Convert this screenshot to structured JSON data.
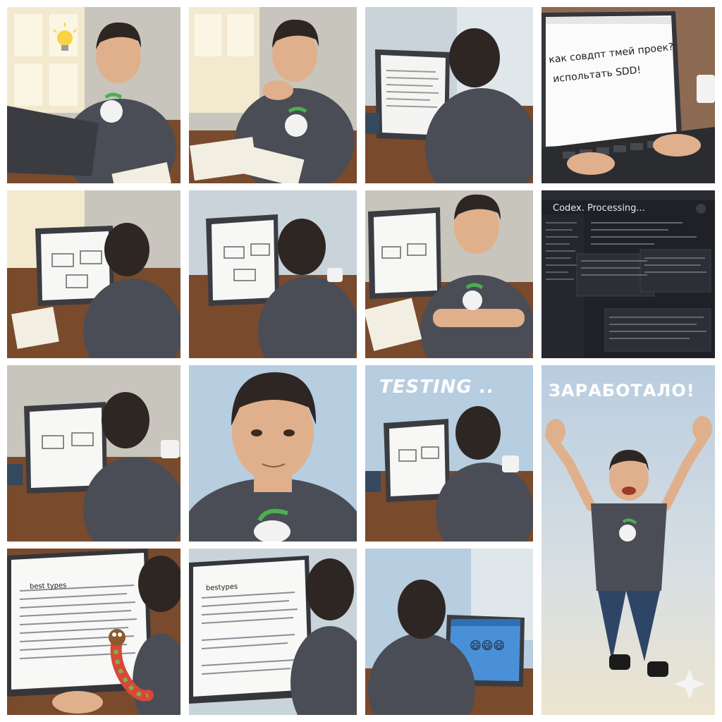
{
  "panels": {
    "screen_question": {
      "line1": "как совдпт тмей проек?",
      "line2": "испольтать SDD!"
    },
    "codex": {
      "title": "Codex. Processing..."
    },
    "testing": {
      "caption": "TESTING .."
    },
    "worked": {
      "caption": "ЗАРАБОТАЛО!"
    },
    "screen_tab": {
      "label": "best types"
    },
    "screen_tab2": {
      "label": "bestypes"
    },
    "success_screen": {
      "emoji": "😄😄😄"
    }
  },
  "colors": {
    "shirt": "#4a4d55",
    "skin": "#e0b08c",
    "hair": "#2e2623",
    "desk": "#7a4a2c",
    "laptop": "#3a3c42",
    "sky": "#b7cde0",
    "code_bg": "#1f2126"
  }
}
